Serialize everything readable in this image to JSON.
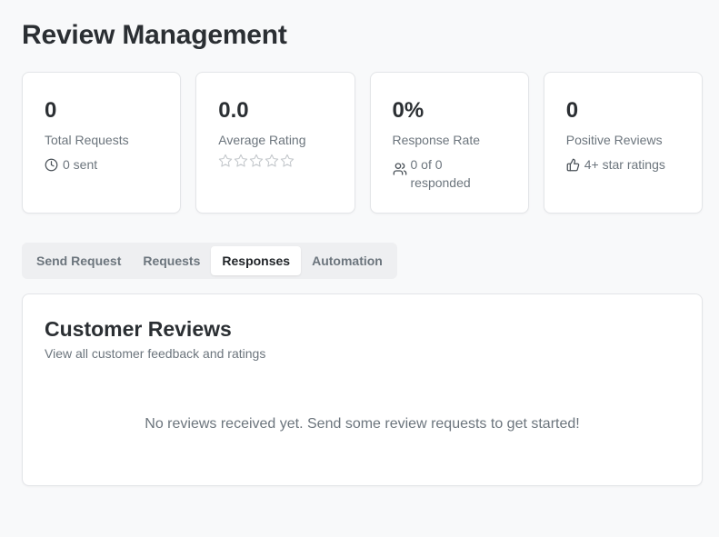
{
  "page": {
    "title": "Review Management"
  },
  "stats": [
    {
      "value": "0",
      "label": "Total Requests",
      "meta": "0 sent",
      "icon": "clock-icon"
    },
    {
      "value": "0.0",
      "label": "Average Rating",
      "rating": 0,
      "max_rating": 5,
      "icon": "star-icon"
    },
    {
      "value": "0%",
      "label": "Response Rate",
      "meta_line1": "0 of 0",
      "meta_line2": "responded",
      "icon": "users-icon"
    },
    {
      "value": "0",
      "label": "Positive Reviews",
      "meta": "4+ star ratings",
      "icon": "thumbs-up-icon"
    }
  ],
  "tabs": [
    {
      "label": "Send Request",
      "active": false
    },
    {
      "label": "Requests",
      "active": false
    },
    {
      "label": "Responses",
      "active": true
    },
    {
      "label": "Automation",
      "active": false
    }
  ],
  "panel": {
    "title": "Customer Reviews",
    "subtitle": "View all customer feedback and ratings",
    "empty_message": "No reviews received yet. Send some review requests to get started!"
  },
  "colors": {
    "background": "#f8f9fa",
    "card": "#ffffff",
    "border": "#e3e5e8",
    "text_primary": "#2b2f33",
    "text_muted": "#6c757d",
    "tab_track": "#eeeff1"
  }
}
